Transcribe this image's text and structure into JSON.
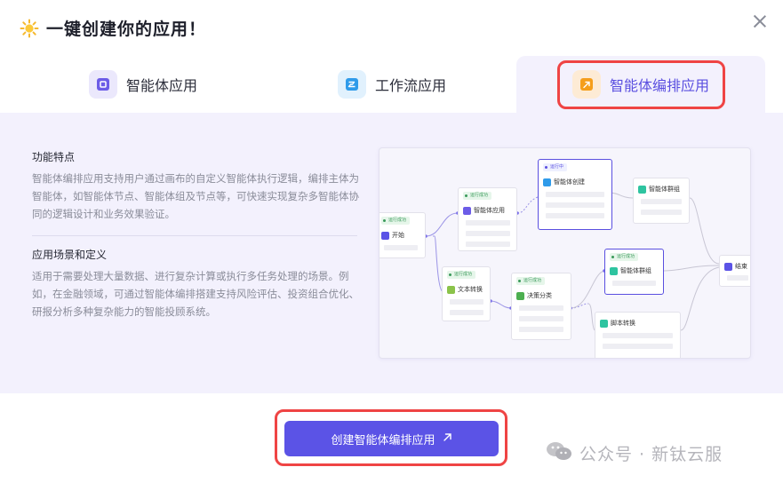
{
  "header": {
    "title": "一键创建你的应用！"
  },
  "tabs": [
    {
      "label": "智能体应用",
      "icon": "agent-app-icon"
    },
    {
      "label": "工作流应用",
      "icon": "workflow-icon"
    },
    {
      "label": "智能体编排应用",
      "icon": "agent-orchestration-icon",
      "active": true
    }
  ],
  "description": {
    "features_title": "功能特点",
    "features_text": "智能体编排应用支持用户通过画布的自定义智能体执行逻辑，编排主体为智能体，如智能体节点、智能体组及节点等，可快速实现复杂多智能体协同的逻辑设计和业务效果验证。",
    "scenarios_title": "应用场景和定义",
    "scenarios_text": "适用于需要处理大量数据、进行复杂计算或执行多任务处理的场景。例如，在金融领域，可通过智能体编排搭建支持风险评估、投资组合优化、研报分析多种复杂能力的智能投顾系统。"
  },
  "preview": {
    "badge_success": "运行成功",
    "badge_running": "运行中",
    "nodes": {
      "start": "开始",
      "agent_app": "智能体应用",
      "agent_create": "智能体创建",
      "agent_group_1": "智能体群组",
      "text_convert": "文本转换",
      "decision": "决策分类",
      "agent_group_2": "智能体群组",
      "script_convert": "脚本转换",
      "end": "结束"
    }
  },
  "footer": {
    "create_button": "创建智能体编排应用",
    "watermark": "公众号 · 新钛云服"
  },
  "colors": {
    "accent": "#5b53e6",
    "highlight": "#ef4444",
    "panel_bg": "#f3f1fd"
  }
}
